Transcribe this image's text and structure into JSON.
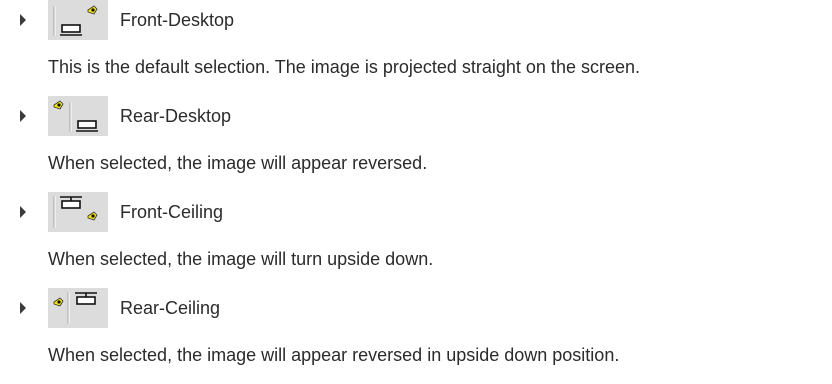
{
  "modes": [
    {
      "label": "Front-Desktop",
      "icon": "projector-front-desktop-icon",
      "description": "This is the default selection. The image is projected straight on the screen."
    },
    {
      "label": "Rear-Desktop",
      "icon": "projector-rear-desktop-icon",
      "description": "When selected, the image will appear reversed."
    },
    {
      "label": "Front-Ceiling",
      "icon": "projector-front-ceiling-icon",
      "description": "When selected, the image will turn upside down."
    },
    {
      "label": "Rear-Ceiling",
      "icon": "projector-rear-ceiling-icon",
      "description": "When selected, the image will appear reversed in upside down position."
    }
  ],
  "colors": {
    "icon_background": "#dcdcdc",
    "light_beam": "#f2e21a",
    "text": "#2b2b2b"
  }
}
